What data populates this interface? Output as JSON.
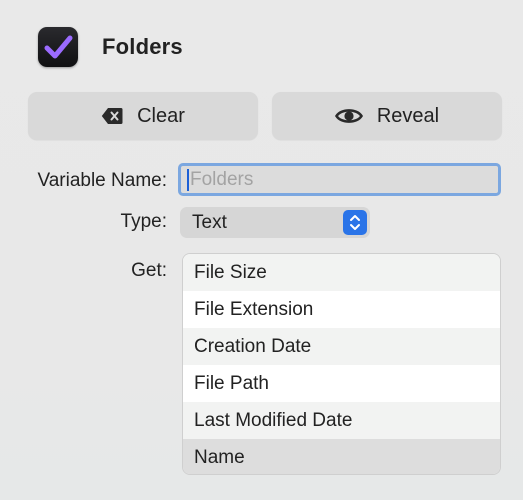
{
  "header": {
    "title": "Folders",
    "icon": "checkmark-app-icon"
  },
  "actions": {
    "clear_label": "Clear",
    "clear_icon": "delete-backward-icon",
    "reveal_label": "Reveal",
    "reveal_icon": "eye-icon"
  },
  "form": {
    "variable_name_label": "Variable Name:",
    "variable_name_value": "",
    "variable_name_placeholder": "Folders",
    "type_label": "Type:",
    "type_value": "Text",
    "get_label": "Get:",
    "get_options": [
      {
        "label": "File Size"
      },
      {
        "label": "File Extension"
      },
      {
        "label": "Creation Date"
      },
      {
        "label": "File Path"
      },
      {
        "label": "Last Modified Date"
      },
      {
        "label": "Name",
        "selected": true
      }
    ]
  },
  "colors": {
    "accent": "#2a74e8",
    "focus_ring": "#7ba7e0",
    "checkmark": "#8b5cf6"
  }
}
